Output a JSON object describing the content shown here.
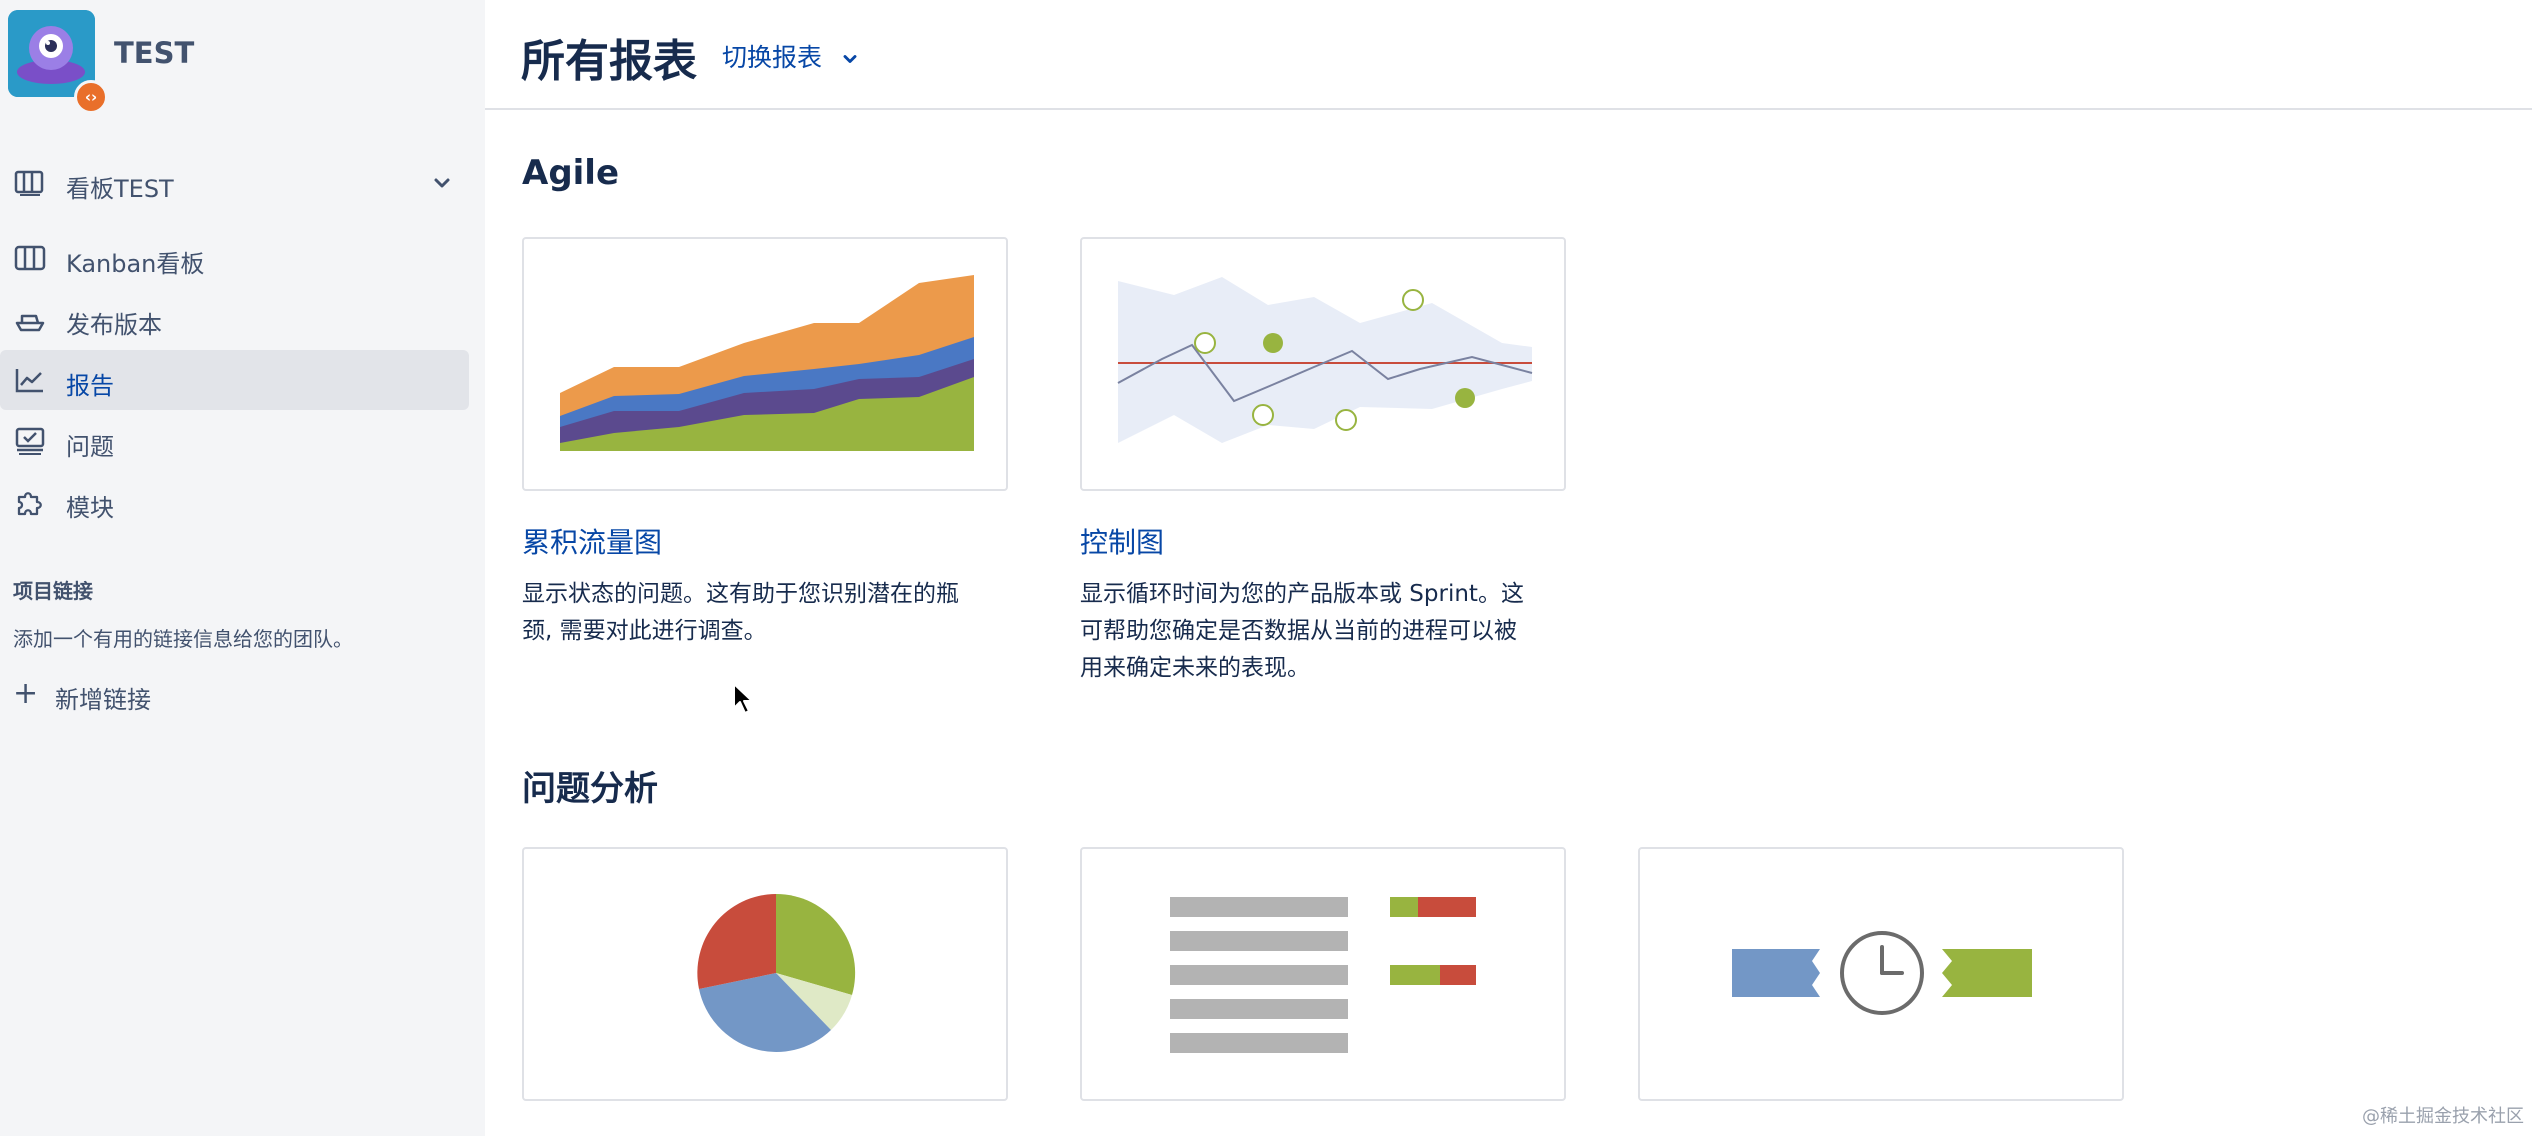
{
  "project": {
    "name": "TEST"
  },
  "sidebar": {
    "board_selector": "看板TEST",
    "items": [
      {
        "label": "Kanban看板",
        "icon": "board-columns-icon"
      },
      {
        "label": "发布版本",
        "icon": "ship-icon"
      },
      {
        "label": "报告",
        "icon": "chart-line-icon",
        "active": true
      },
      {
        "label": "问题",
        "icon": "issues-icon"
      },
      {
        "label": "模块",
        "icon": "puzzle-icon"
      }
    ],
    "project_links": {
      "title": "项目链接",
      "description": "添加一个有用的链接信息给您的团队。",
      "add_label": "新增链接"
    }
  },
  "header": {
    "title": "所有报表",
    "switch_label": "切换报表"
  },
  "groups": [
    {
      "title": "Agile",
      "reports": [
        {
          "title": "累积流量图",
          "description_lines": [
            "显示状态的问题。这有助于您识别潜在的瓶",
            "颈, 需要对此进行调查。"
          ],
          "icon": "cumulative-flow-diagram-thumbnail"
        },
        {
          "title": "控制图",
          "description_lines": [
            "显示循环时间为您的产品版本或 Sprint。这",
            "可帮助您确定是否数据从当前的进程可以被",
            "用来确定未来的表现。"
          ],
          "icon": "control-chart-thumbnail"
        }
      ]
    },
    {
      "title": "问题分析",
      "reports": [
        {
          "icon": "pie-chart-thumbnail"
        },
        {
          "icon": "list-bar-thumbnail"
        },
        {
          "icon": "time-tracking-thumbnail"
        }
      ]
    }
  ],
  "watermark": "@稀土掘金技术社区",
  "colors": {
    "link": "#0747a6",
    "orange": "#ec9a4b",
    "blue": "#4a78c4",
    "purple": "#5b4a8e",
    "green": "#98b440",
    "red": "#c84c3c",
    "pie_blue": "#7397c6"
  }
}
